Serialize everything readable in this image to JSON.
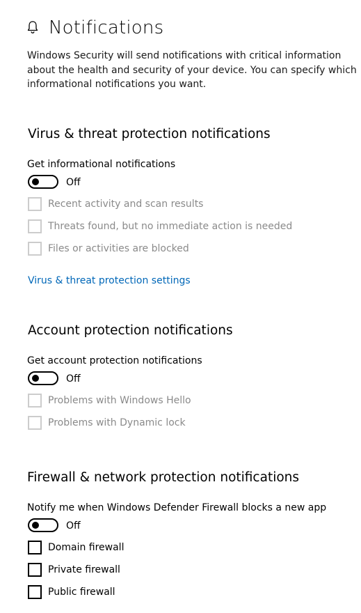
{
  "page": {
    "title": "Notifications",
    "icon": "bell-icon",
    "description": "Windows Security will send notifications with critical information about the health and security of your device. You can specify which informational notifications you want."
  },
  "colors": {
    "link": "#0067b8",
    "disabled_text": "#8a8a8a",
    "disabled_border": "#cccccc"
  },
  "virus": {
    "heading": "Virus & threat protection notifications",
    "toggle_label": "Get informational notifications",
    "toggle_state": "Off",
    "checkboxes": [
      {
        "label": "Recent activity and scan results",
        "checked": false,
        "disabled": true
      },
      {
        "label": "Threats found, but no immediate action is needed",
        "checked": false,
        "disabled": true
      },
      {
        "label": "Files or activities are blocked",
        "checked": false,
        "disabled": true
      }
    ],
    "settings_link": "Virus & threat protection settings"
  },
  "account": {
    "heading": "Account protection notifications",
    "toggle_label": "Get account protection notifications",
    "toggle_state": "Off",
    "checkboxes": [
      {
        "label": "Problems with Windows Hello",
        "checked": false,
        "disabled": true
      },
      {
        "label": "Problems with Dynamic lock",
        "checked": false,
        "disabled": true
      }
    ]
  },
  "firewall": {
    "heading": "Firewall & network protection notifications",
    "toggle_label": "Notify me when Windows Defender Firewall blocks a new app",
    "toggle_state": "Off",
    "checkboxes": [
      {
        "label": "Domain firewall",
        "checked": false,
        "disabled": false
      },
      {
        "label": "Private firewall",
        "checked": false,
        "disabled": false
      },
      {
        "label": "Public firewall",
        "checked": false,
        "disabled": false
      }
    ]
  }
}
